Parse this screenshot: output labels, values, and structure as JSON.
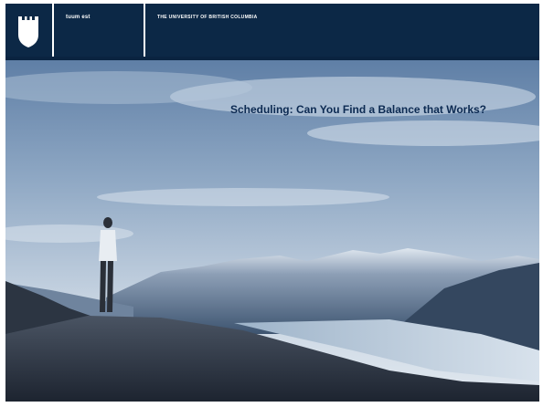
{
  "header": {
    "motto": "tuum est",
    "university": "THE UNIVERSITY OF BRITISH COLUMBIA"
  },
  "slide": {
    "title": "Scheduling: Can You Find a Balance that Works?"
  },
  "colors": {
    "header_bg": "#0c2846",
    "title_text": "#0c2a52"
  },
  "icons": [
    "ubc-crest-icon"
  ]
}
